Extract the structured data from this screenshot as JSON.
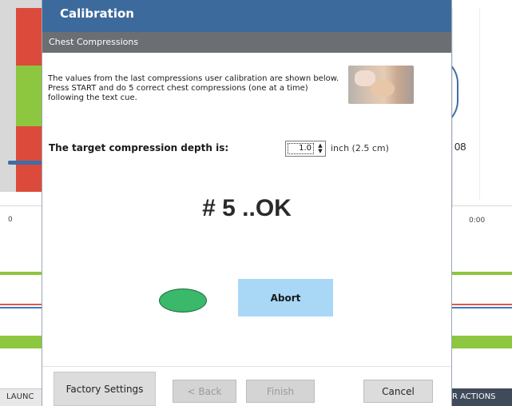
{
  "dialog": {
    "title": "Calibration",
    "subtitle": "Chest Compressions",
    "instructions": "The values from the last compressions user calibration are shown below.  Press START and do 5 correct chest compressions (one at a time) following the text cue.",
    "target_label": "The target compression depth is:",
    "depth_value": "1.0",
    "depth_unit": "inch (2.5 cm)",
    "status": "# 5 ..OK",
    "indicator_color": "#3ab96a",
    "abort_label": "Abort",
    "buttons": {
      "factory": "Factory Settings",
      "back": "< Back",
      "finish": "Finish",
      "cancel": "Cancel"
    }
  },
  "background": {
    "readout": "08",
    "tick_zero": "0",
    "tick_time": "0:00",
    "footer_left": "LAUNC",
    "footer_right": "R ACTIONS",
    "colors": {
      "red": "#dc4a3c",
      "green": "#8dc63f",
      "blue": "#3d6ea6"
    }
  }
}
